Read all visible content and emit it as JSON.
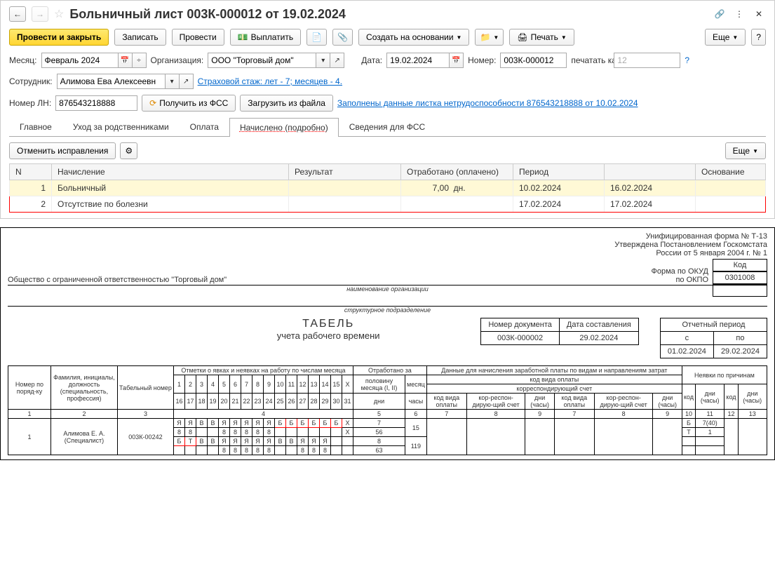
{
  "header": {
    "title": "Больничный лист 003К-000012 от 19.02.2024"
  },
  "toolbar": {
    "provesti_zakryt": "Провести и закрыть",
    "zapisat": "Записать",
    "provesti": "Провести",
    "vyplatit": "Выплатить",
    "sozdat": "Создать на основании",
    "pechat": "Печать",
    "eshe": "Еще"
  },
  "fields": {
    "month_label": "Месяц:",
    "month_value": "Февраль 2024",
    "org_label": "Организация:",
    "org_value": "ООО \"Торговый дом\"",
    "date_label": "Дата:",
    "date_value": "19.02.2024",
    "number_label": "Номер:",
    "number_value": "003К-000012",
    "print_as_label": "печатать как:",
    "print_as_value": "12",
    "employee_label": "Сотрудник:",
    "employee_value": "Алимова Ева Алексеевн",
    "stazh_link": "Страховой стаж: лет - 7; месяцев - 4.",
    "ln_label": "Номер ЛН:",
    "ln_value": "876543218888",
    "get_fss": "Получить из ФСС",
    "load_file": "Загрузить из файла",
    "fill_link": "Заполнены данные листка нетрудоспособности 876543218888 от 10.02.2024"
  },
  "tabs": [
    "Главное",
    "Уход за родственниками",
    "Оплата",
    "Начислено (подробно)",
    "Сведения для ФСС"
  ],
  "grid_toolbar": {
    "cancel_corr": "Отменить исправления",
    "eshe": "Еще"
  },
  "grid": {
    "headers": [
      "N",
      "Начисление",
      "Результат",
      "Отработано (оплачено)",
      "Период",
      "",
      "Основание"
    ],
    "rows": [
      {
        "n": "1",
        "name": "Больничный",
        "result": "",
        "worked": "7,00",
        "unit": "дн.",
        "from": "10.02.2024",
        "to": "16.02.2024"
      },
      {
        "n": "2",
        "name": "Отсутствие по болезни",
        "result": "",
        "worked": "",
        "unit": "",
        "from": "17.02.2024",
        "to": "17.02.2024"
      }
    ]
  },
  "report": {
    "form_line1": "Унифицированная форма № Т-13",
    "form_line2": "Утверждена Постановлением Госкомстата",
    "form_line3": "России от 5 января 2004 г. № 1",
    "code_label": "Код",
    "okud_label": "Форма по ОКУД",
    "okud_value": "0301008",
    "okpo_label": "по ОКПО",
    "org": "Общество с ограниченной ответственностью \"Торговый дом\"",
    "org_sub": "наименование организации",
    "dept_sub": "структурное подразделение",
    "title": "ТАБЕЛЬ",
    "subtitle": "учета  рабочего времени",
    "doc_no_label": "Номер документа",
    "doc_no": "003К-000002",
    "doc_date_label": "Дата составления",
    "doc_date": "29.02.2024",
    "period_label": "Отчетный период",
    "period_from_label": "с",
    "period_to_label": "по",
    "period_from": "01.02.2024",
    "period_to": "29.02.2024"
  },
  "timesheet": {
    "head": {
      "npp": "Номер по поряд-ку",
      "fio": "Фамилия, инициалы, должность (специальность, профессия)",
      "tabno": "Табельный номер",
      "marks": "Отметки о явках и неявках на работу по числам месяца",
      "worked": "Отработано за",
      "half": "половину месяца (I, II)",
      "month": "месяц",
      "days": "дни",
      "hours": "часы",
      "payroll": "Данные для начисления заработной платы по видам и направлениям затрат",
      "paycode": "код вида оплаты",
      "corr": "корреспондирующий счет",
      "paycode2": "код вида оплаты",
      "corr2": "кор-респон-дирую-щий счет",
      "dayshours": "дни (часы)",
      "absence": "Неявки по причинам",
      "code": "код"
    },
    "colnums": [
      "1",
      "2",
      "3",
      "4",
      "5",
      "6",
      "7",
      "8",
      "9",
      "10",
      "11",
      "12",
      "13"
    ],
    "days1": [
      "1",
      "2",
      "3",
      "4",
      "5",
      "6",
      "7",
      "8",
      "9",
      "10",
      "11",
      "12",
      "13",
      "14",
      "15",
      "X"
    ],
    "days2": [
      "16",
      "17",
      "18",
      "19",
      "20",
      "21",
      "22",
      "23",
      "24",
      "25",
      "26",
      "27",
      "28",
      "29",
      "30",
      "31"
    ],
    "row": {
      "n": "1",
      "fio": "Алимова Е. А. (Специалист)",
      "tab": "003К-00242",
      "marks1": [
        "Я",
        "Я",
        "В",
        "В",
        "Я",
        "Я",
        "Я",
        "Я",
        "Я",
        "Б",
        "Б",
        "Б",
        "Б",
        "Б",
        "Б",
        "X"
      ],
      "hours1": [
        "8",
        "8",
        "",
        "",
        "8",
        "8",
        "8",
        "8",
        "8",
        "",
        "",
        "",
        "",
        "",
        "",
        "X"
      ],
      "marks2": [
        "Б",
        "Т",
        "В",
        "В",
        "Я",
        "Я",
        "Я",
        "Я",
        "Я",
        "В",
        "В",
        "Я",
        "Я",
        "Я",
        "",
        ""
      ],
      "hours2": [
        "",
        "",
        "",
        "",
        "8",
        "8",
        "8",
        "8",
        "8",
        "",
        "",
        "8",
        "8",
        "8",
        "",
        ""
      ],
      "half1_days": "7",
      "half1_hours": "56",
      "half2_days": "8",
      "half2_hours": "63",
      "month_days": "15",
      "month_hours": "119",
      "abs": [
        [
          "Б",
          "7(40)"
        ],
        [
          "Т",
          "1"
        ]
      ]
    }
  }
}
